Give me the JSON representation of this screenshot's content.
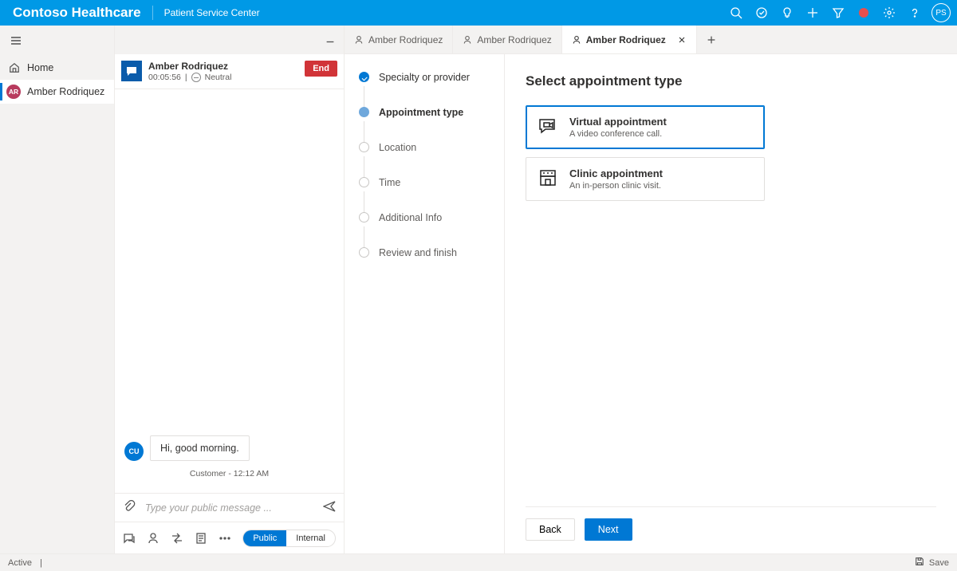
{
  "header": {
    "brand": "Contoso Healthcare",
    "sub": "Patient Service Center",
    "avatar": "PS"
  },
  "leftnav": {
    "items": [
      {
        "id": "home",
        "label": "Home"
      },
      {
        "id": "amber",
        "label": "Amber Rodriquez",
        "badge": "AR"
      }
    ]
  },
  "session": {
    "name": "Amber Rodriquez",
    "timer": "00:05:56",
    "sentiment": "Neutral",
    "end": "End",
    "msg_badge": "CU",
    "msg_text": "Hi, good morning.",
    "msg_meta": "Customer - 12:12 AM",
    "placeholder": "Type your public message ...",
    "pill_public": "Public",
    "pill_internal": "Internal"
  },
  "tabs": [
    {
      "label": "Amber Rodriquez"
    },
    {
      "label": "Amber Rodriquez"
    },
    {
      "label": "Amber Rodriquez",
      "active": true,
      "closable": true
    }
  ],
  "steps": [
    {
      "label": "Specialty or provider",
      "state": "done"
    },
    {
      "label": "Appointment type",
      "state": "current"
    },
    {
      "label": "Location",
      "state": ""
    },
    {
      "label": "Time",
      "state": ""
    },
    {
      "label": "Additional Info",
      "state": ""
    },
    {
      "label": "Review and finish",
      "state": ""
    }
  ],
  "detail": {
    "heading": "Select appointment type",
    "cards": [
      {
        "title": "Virtual appointment",
        "sub": "A video conference call.",
        "selected": true,
        "icon": "video"
      },
      {
        "title": "Clinic appointment",
        "sub": "An in-person clinic visit.",
        "selected": false,
        "icon": "clinic"
      }
    ],
    "back": "Back",
    "next": "Next"
  },
  "statusbar": {
    "active": "Active",
    "save": "Save"
  }
}
